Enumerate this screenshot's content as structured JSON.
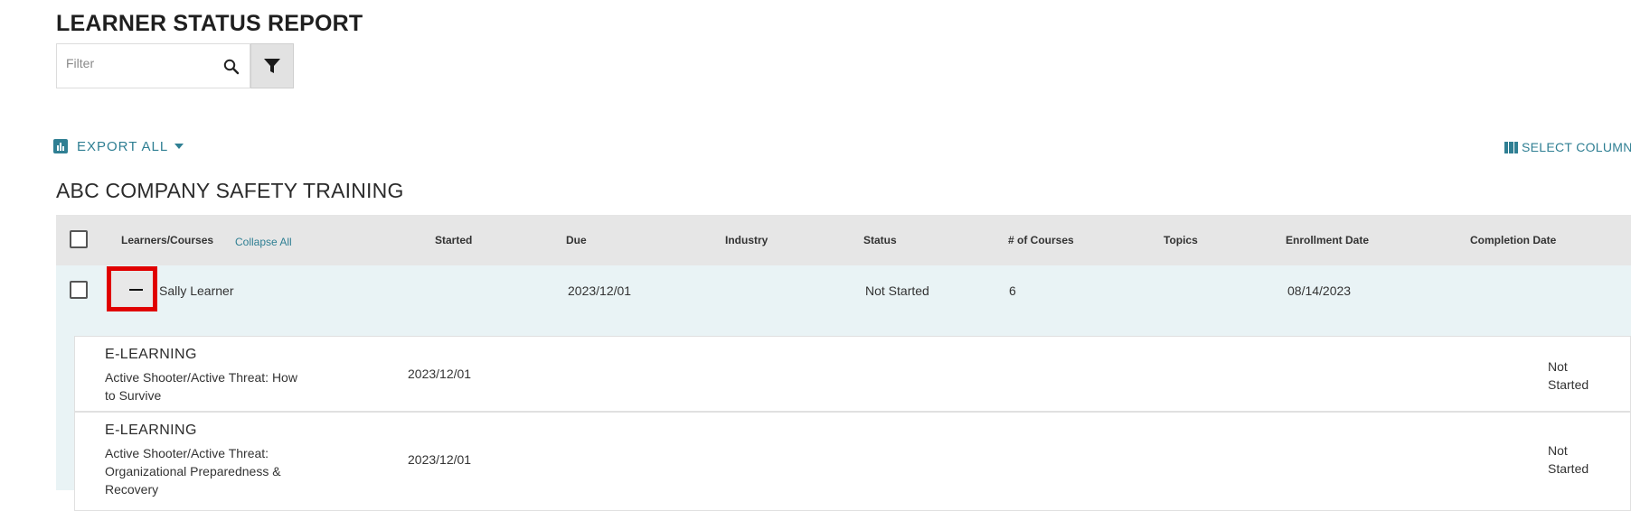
{
  "page": {
    "title": "LEARNER STATUS REPORT"
  },
  "filter": {
    "placeholder": "Filter",
    "value": ""
  },
  "toolbar": {
    "export_label": "EXPORT ALL",
    "select_columns_label": "SELECT COLUMNS"
  },
  "report": {
    "title": "ABC COMPANY SAFETY TRAINING"
  },
  "table": {
    "collapse_all_label": "Collapse All",
    "headers": {
      "learners": "Learners/Courses",
      "started": "Started",
      "due": "Due",
      "industry": "Industry",
      "status": "Status",
      "courses": "# of Courses",
      "topics": "Topics",
      "enrollment": "Enrollment Date",
      "completion": "Completion Date"
    }
  },
  "learner": {
    "name": "Sally Learner",
    "started": "",
    "due": "2023/12/01",
    "industry": "",
    "status": "Not Started",
    "courses": "6",
    "topics": "",
    "enrollment": "08/14/2023",
    "completion": "",
    "expanded": true
  },
  "courses": [
    {
      "type": "E-LEARNING",
      "name": "Active Shooter/Active Threat: How to Survive",
      "due": "2023/12/01",
      "status": "Not Started"
    },
    {
      "type": "E-LEARNING",
      "name": "Active Shooter/Active Threat: Organizational Preparedness & Recovery",
      "due": "2023/12/01",
      "status": "Not Started"
    }
  ],
  "colors": {
    "accent": "#2f7f93",
    "highlight": "#e00000",
    "row_bg": "#e9f3f5",
    "header_bg": "#e6e6e6"
  },
  "icons": {
    "search": "search-icon",
    "filter": "funnel-icon",
    "export": "bar-chart-icon",
    "export_caret": "caret-down-icon",
    "columns": "columns-icon",
    "collapse": "minus-icon"
  }
}
